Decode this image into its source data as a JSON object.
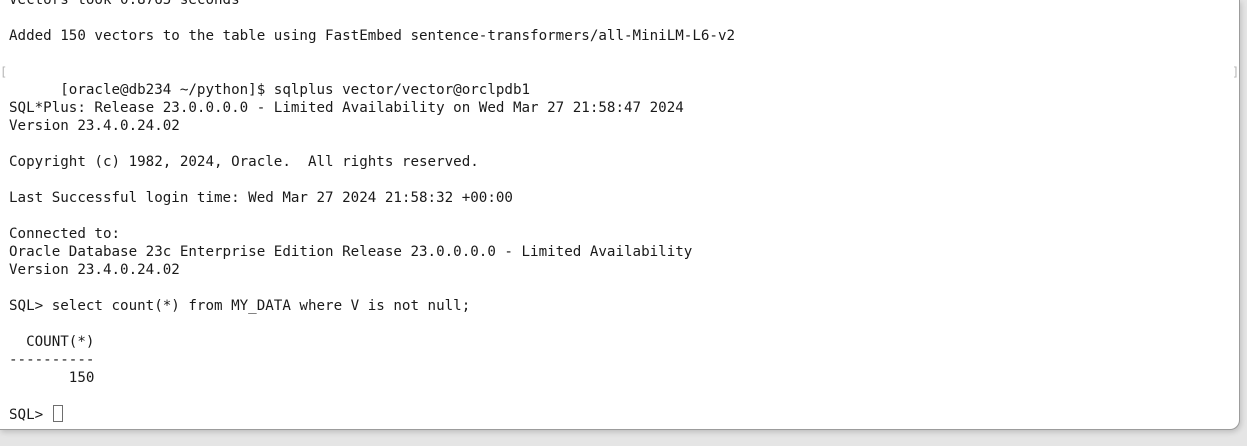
{
  "terminal": {
    "lines": [
      "Vectors took 0.8765 seconds",
      "",
      "Added 150 vectors to the table using FastEmbed sentence-transformers/all-MiniLM-L6-v2",
      "",
      "[oracle@db234 ~/python]$ sqlplus vector/vector@orclpdb1",
      "",
      "SQL*Plus: Release 23.0.0.0.0 - Limited Availability on Wed Mar 27 21:58:47 2024",
      "Version 23.4.0.24.02",
      "",
      "Copyright (c) 1982, 2024, Oracle.  All rights reserved.",
      "",
      "Last Successful login time: Wed Mar 27 2024 21:58:32 +00:00",
      "",
      "Connected to:",
      "Oracle Database 23c Enterprise Edition Release 23.0.0.0.0 - Limited Availability",
      "Version 23.4.0.24.02",
      "",
      "SQL> select count(*) from MY_DATA where V is not null;",
      "",
      "  COUNT(*)",
      "----------",
      "       150",
      ""
    ],
    "current_prompt": "SQL> ",
    "bracket_left": "[",
    "bracket_right": "]"
  }
}
